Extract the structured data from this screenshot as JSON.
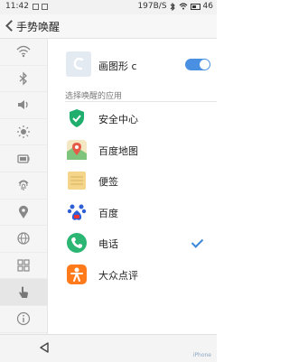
{
  "status_bar": {
    "time": "11:42",
    "network_speed": "197B/S",
    "battery": "46"
  },
  "header": {
    "title": "手势唤醒"
  },
  "sidebar": {
    "items": [
      {
        "icon": "wifi-icon",
        "active": false
      },
      {
        "icon": "bluetooth-icon",
        "active": false
      },
      {
        "icon": "volume-icon",
        "active": false
      },
      {
        "icon": "brightness-icon",
        "active": false
      },
      {
        "icon": "battery-icon",
        "active": false
      },
      {
        "icon": "fingerprint-icon",
        "active": false
      },
      {
        "icon": "location-icon",
        "active": false
      },
      {
        "icon": "globe-icon",
        "active": false
      },
      {
        "icon": "apps-grid-icon",
        "active": false
      },
      {
        "icon": "gesture-hand-icon",
        "active": true
      },
      {
        "icon": "info-icon",
        "active": false
      }
    ]
  },
  "gesture": {
    "label": "画图形 c",
    "enabled": true
  },
  "section": {
    "label": "选择唤醒的应用"
  },
  "apps": [
    {
      "name": "安全中心",
      "icon": "security-shield-icon",
      "color": "#1fae6e",
      "selected": false
    },
    {
      "name": "百度地图",
      "icon": "map-icon",
      "color": "#e65a4a",
      "selected": false
    },
    {
      "name": "便签",
      "icon": "notes-icon",
      "color": "#f4d58a",
      "selected": false
    },
    {
      "name": "百度",
      "icon": "baidu-paw-icon",
      "color": "#2f5fd6",
      "selected": false
    },
    {
      "name": "电话",
      "icon": "phone-icon",
      "color": "#2bb673",
      "selected": true
    },
    {
      "name": "大众点评",
      "icon": "dianping-icon",
      "color": "#ff7a1a",
      "selected": false
    }
  ],
  "watermark": "iPhone"
}
